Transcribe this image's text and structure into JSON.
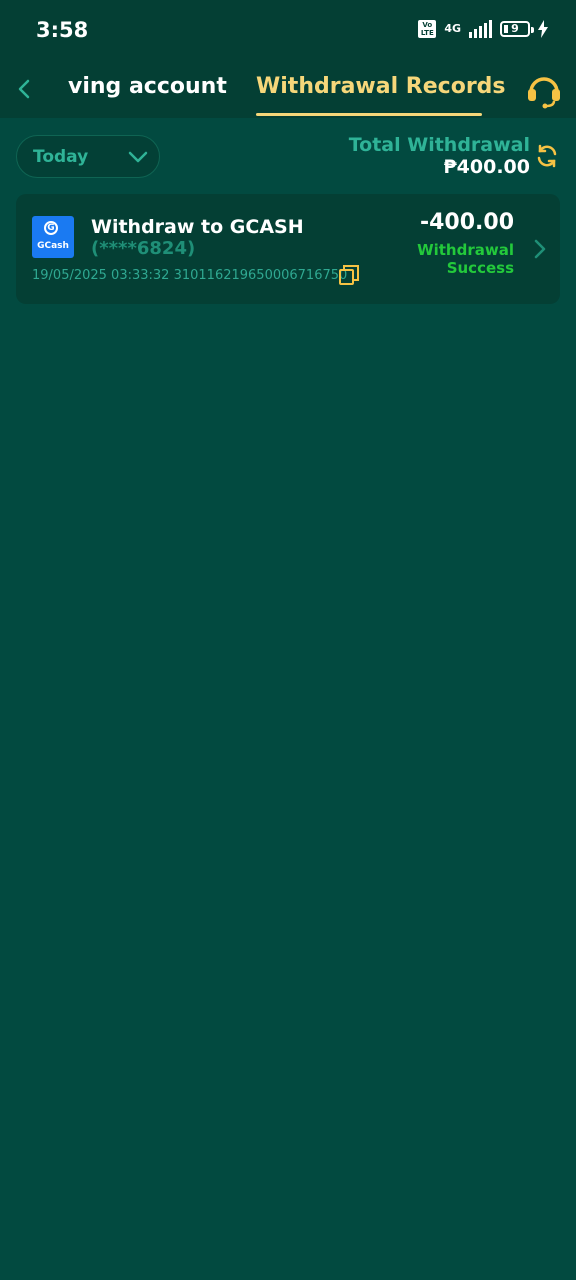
{
  "status_bar": {
    "time": "3:58",
    "volte": "Vo LTE",
    "network": "4G",
    "battery_level": "9",
    "icons": [
      "volte-icon",
      "signal-icon",
      "battery-icon",
      "charging-icon"
    ]
  },
  "nav": {
    "back_icon": "chevron-left-icon",
    "tab_saving": "ving account",
    "tab_records": "Withdrawal Records",
    "support_icon": "headset-icon"
  },
  "filter": {
    "selected": "Today",
    "icon": "chevron-down-icon"
  },
  "summary": {
    "total_label": "Total Withdrawal",
    "total_amount": "₱400.00",
    "refresh_icon": "refresh-icon"
  },
  "records": [
    {
      "logo_text": "GCash",
      "title": "Withdraw to GCASH",
      "account": "(****6824)",
      "datetime": "19/05/2025 03:33:32",
      "order_id": "310116219650006716750",
      "amount": "-400.00",
      "status_line1": "Withdrawal",
      "status_line2": "Success",
      "copy_icon": "copy-icon",
      "chevron_icon": "chevron-right-icon"
    }
  ],
  "colors": {
    "background": "#024a40",
    "header": "#043f34",
    "accent_gold": "#f6d77a",
    "teal_text": "#2fb397",
    "success_green": "#23c93b",
    "gcash_blue": "#1a7af2"
  }
}
